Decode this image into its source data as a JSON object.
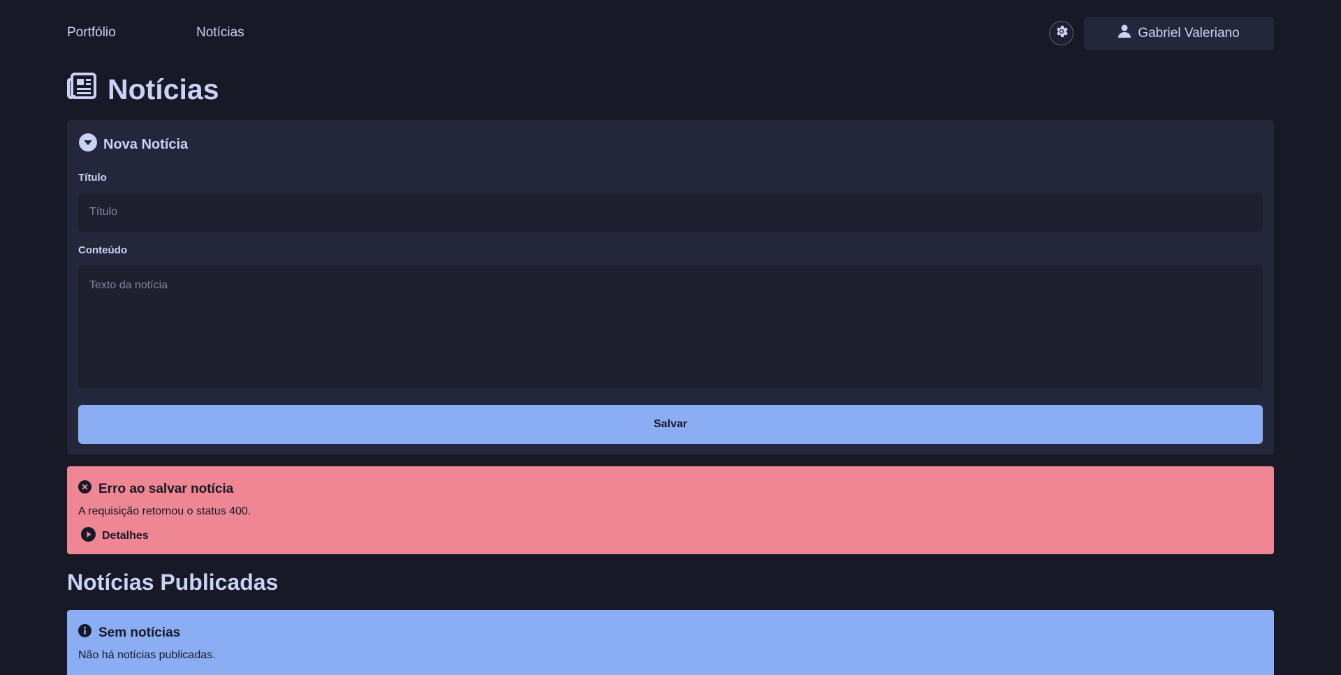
{
  "nav": {
    "portfolio": "Portfólio",
    "news": "Notícias",
    "theme_icon": "gear-icon",
    "user_name": "Gabriel Valeriano"
  },
  "page": {
    "title": "Notícias"
  },
  "form": {
    "summary": "Nova Notícia",
    "title_label": "Título",
    "title_placeholder": "Título",
    "title_value": "",
    "content_label": "Conteúdo",
    "content_placeholder": "Texto da notícia",
    "content_value": "",
    "save_label": "Salvar"
  },
  "error": {
    "title": "Erro ao salvar notícia",
    "message": "A requisição retornou o status 400.",
    "details_label": "Detalhes"
  },
  "published": {
    "title": "Notícias Publicadas",
    "empty_title": "Sem notícias",
    "empty_message": "Não há notícias publicadas."
  },
  "colors": {
    "background": "#181926",
    "card": "#24273a",
    "accent_blue": "#8aadf4",
    "error_red": "#ee8693"
  }
}
